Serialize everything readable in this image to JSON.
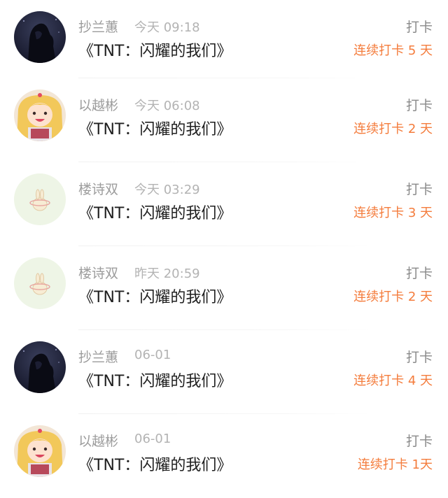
{
  "rows": [
    {
      "avatar": "dark-night-silhouette-avatar",
      "name": "抄兰蕙",
      "time": "今天 09:18",
      "title": "《TNT：闪耀的我们》",
      "action": "打卡",
      "streak": "连续打卡 5 天"
    },
    {
      "avatar": "anime-girl-avatar",
      "name": "以越彬",
      "time": "今天 06:08",
      "title": "《TNT：闪耀的我们》",
      "action": "打卡",
      "streak": "连续打卡 2 天"
    },
    {
      "avatar": "bunny-sticker-avatar",
      "name": "楼诗双",
      "time": "今天 03:29",
      "title": "《TNT：闪耀的我们》",
      "action": "打卡",
      "streak": "连续打卡 3 天"
    },
    {
      "avatar": "bunny-sticker-avatar",
      "name": "楼诗双",
      "time": "昨天 20:59",
      "title": "《TNT：闪耀的我们》",
      "action": "打卡",
      "streak": "连续打卡 2 天"
    },
    {
      "avatar": "dark-night-silhouette-avatar",
      "name": "抄兰蕙",
      "time": "06-01",
      "title": "《TNT：闪耀的我们》",
      "action": "打卡",
      "streak": "连续打卡 4 天"
    },
    {
      "avatar": "anime-girl-avatar",
      "name": "以越彬",
      "time": "06-01",
      "title": "《TNT：闪耀的我们》",
      "action": "打卡",
      "streak": "连续打卡 1天"
    }
  ],
  "colors": {
    "streak": "#f47c3c",
    "name": "#9c9c9c",
    "time": "#b3b3b3",
    "title": "#1f1f1f"
  }
}
